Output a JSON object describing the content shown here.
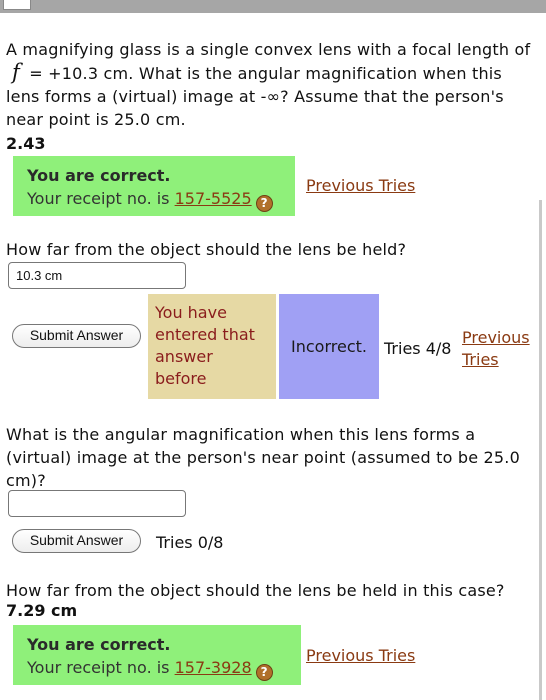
{
  "question1": {
    "text_before": "A magnifying glass is a single convex lens with a focal length of ",
    "symbol": "f",
    "text_after": " = +10.3 cm. What is the angular magnification when this lens forms a (virtual) image at -∞? Assume that the person's near point is 25.0 cm.",
    "answer": "2.43",
    "status_title": "You are correct.",
    "receipt_prefix": "Your receipt no. is ",
    "receipt_no": "157-5525",
    "previous_tries": "Previous Tries"
  },
  "question2": {
    "text": "How far from the object should the lens be held?",
    "input_value": "10.3 cm",
    "submit_label": "Submit Answer",
    "entered_message": "You have entered that answer before",
    "status": "Incorrect.",
    "tries": "Tries 4/8",
    "previous_tries": "Previous Tries"
  },
  "question3": {
    "text": "What is the angular magnification when this lens forms a (virtual) image at the person's near point (assumed to be 25.0 cm)?",
    "input_value": "",
    "submit_label": "Submit Answer",
    "tries": "Tries 0/8"
  },
  "question4": {
    "text": "How far from the object should the lens be held in this case?",
    "answer": "7.29 cm",
    "status_title": "You are correct.",
    "receipt_prefix": "Your receipt no. is ",
    "receipt_no": "157-3928",
    "previous_tries": "Previous Tries"
  },
  "icons": {
    "help": "help-icon",
    "help_glyph": "?"
  },
  "colors": {
    "correct_bg": "#8ff07a",
    "entered_bg": "#e6d9a4",
    "incorrect_bg": "#a0a0f4",
    "link": "#8a3a12"
  }
}
